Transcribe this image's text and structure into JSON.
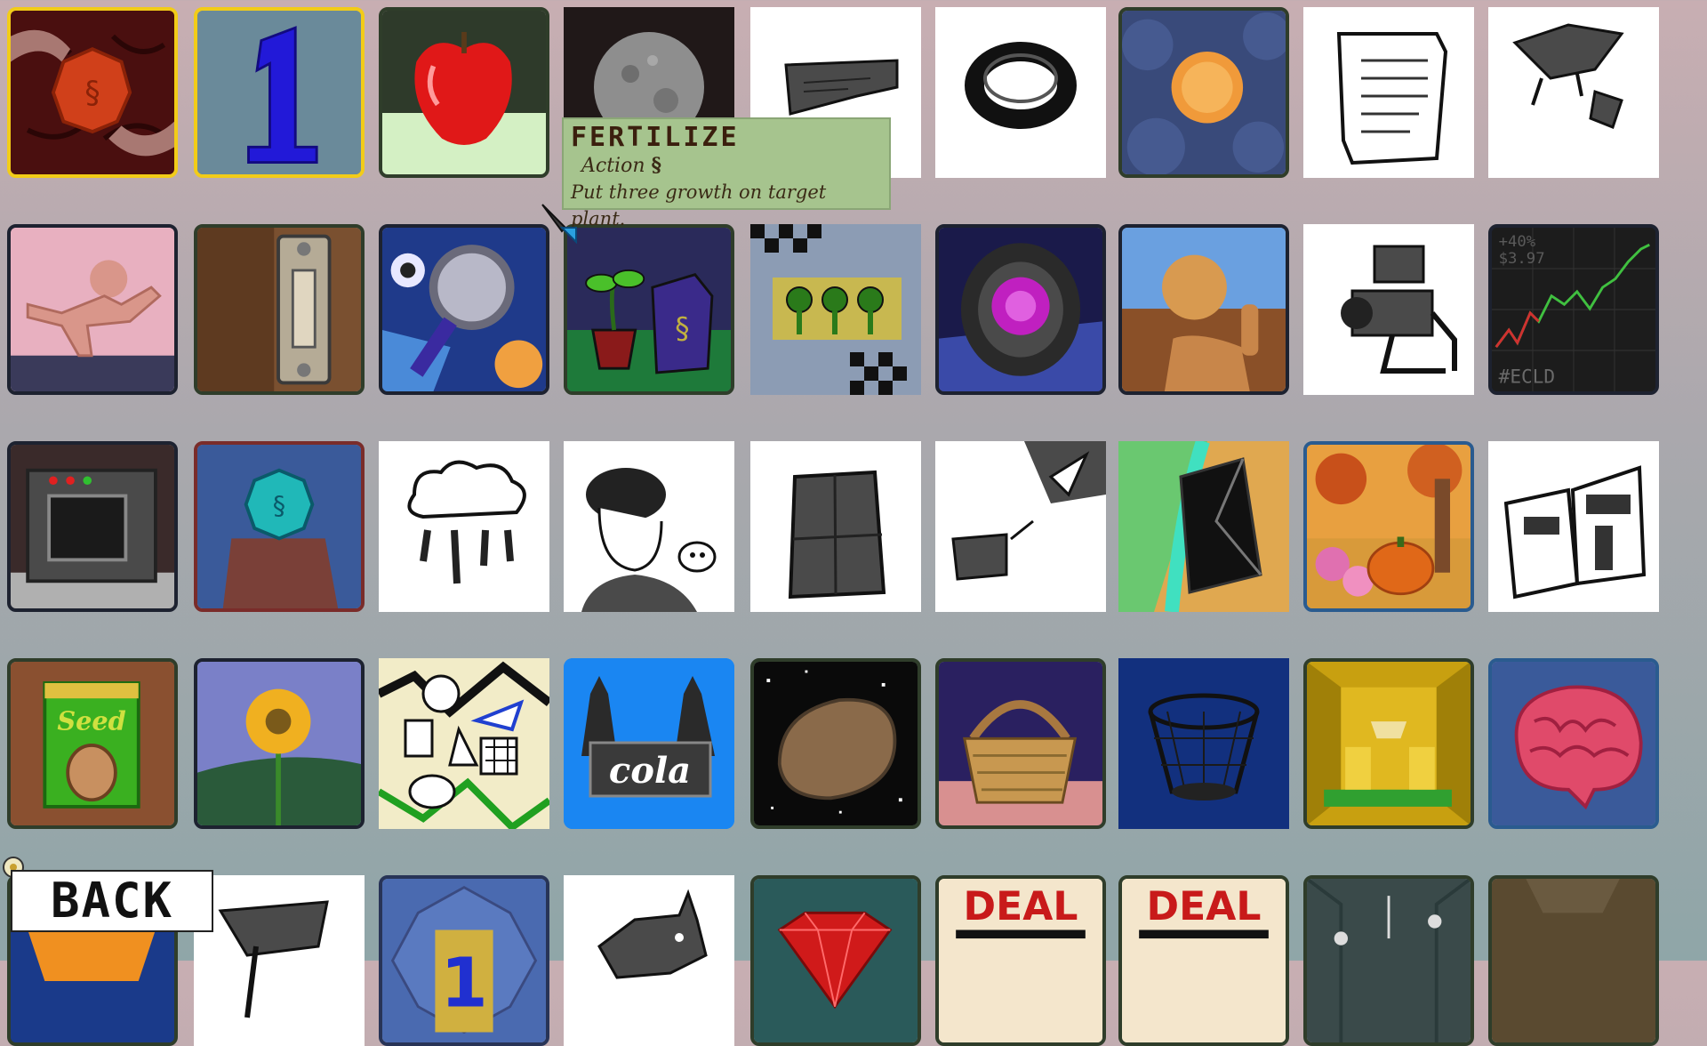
{
  "tooltip": {
    "title": "FERTILIZE",
    "type_label": "Action",
    "type_icon": "seed-bag-icon",
    "description": "Put three growth on target plant."
  },
  "back_button": {
    "label": "BACK"
  },
  "cards": {
    "token_hands": {
      "label": ""
    },
    "number_one": {
      "label": "1"
    },
    "apple": {
      "label": ""
    },
    "moon": {
      "label": ""
    },
    "check": {
      "label": ""
    },
    "ring": {
      "label": ""
    },
    "coin_pond": {
      "label": ""
    },
    "scroll": {
      "label": ""
    },
    "bird": {
      "label": ""
    },
    "gingerbread": {
      "label": ""
    },
    "door_light_switch": {
      "label": ""
    },
    "magnifier": {
      "label": ""
    },
    "fertilize": {
      "label": ""
    },
    "checker_trees": {
      "label": ""
    },
    "portal_eye": {
      "label": ""
    },
    "thumbs_up_sun": {
      "label": ""
    },
    "meat_grinder": {
      "label": ""
    },
    "stock_chart": {
      "ticker": "#ECLD",
      "change": "+40%",
      "price": "$3.97"
    },
    "oven": {
      "label": ""
    },
    "token_stump": {
      "label": ""
    },
    "rain_cloud": {
      "label": ""
    },
    "skull_figure": {
      "label": ""
    },
    "fridge": {
      "label": ""
    },
    "box_arrow": {
      "label": ""
    },
    "crystal_river": {
      "label": ""
    },
    "pumpkin_autumn": {
      "label": ""
    },
    "newspaper": {
      "label": ""
    },
    "seed_packet": {
      "label": "Seed"
    },
    "sunflower": {
      "label": ""
    },
    "shapes_chaos": {
      "label": ""
    },
    "cola": {
      "label": "cola"
    },
    "potato_space": {
      "label": ""
    },
    "basket": {
      "label": ""
    },
    "wire_basket": {
      "label": ""
    },
    "treasure_room": {
      "label": ""
    },
    "brain": {
      "label": ""
    },
    "flag": {
      "label": ""
    },
    "number_one_ornate": {
      "label": "1"
    },
    "dog": {
      "label": ""
    },
    "ruby": {
      "label": ""
    },
    "deal_1": {
      "label": "DEAL"
    },
    "deal_2": {
      "label": "DEAL"
    },
    "chandelier": {
      "label": ""
    },
    "dim_room": {
      "label": ""
    }
  }
}
